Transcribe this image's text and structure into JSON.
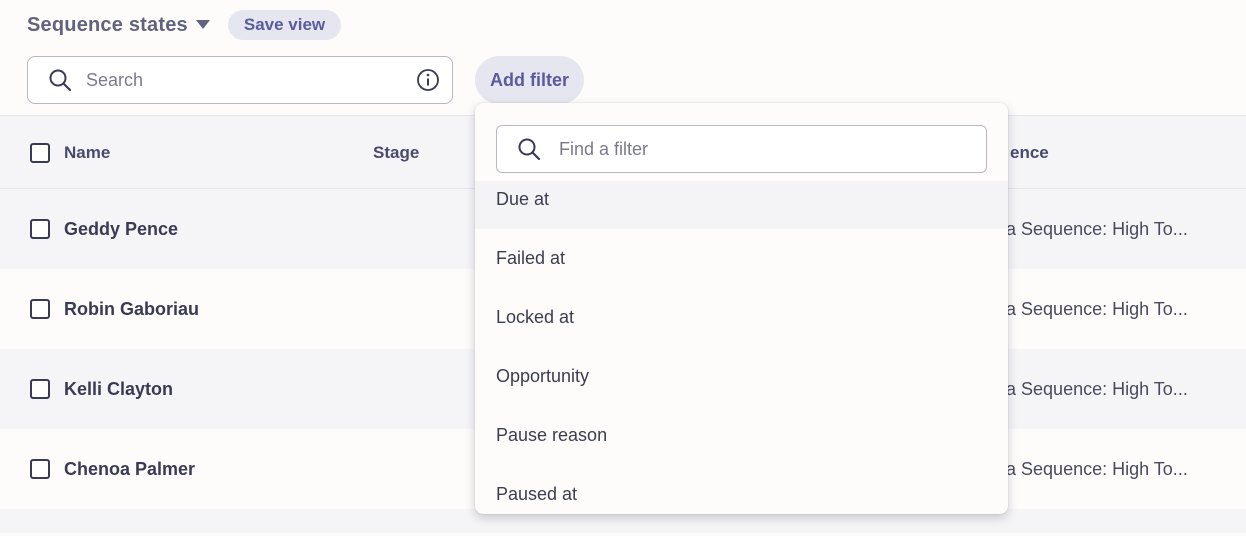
{
  "header": {
    "view_title": "Sequence states",
    "save_view_label": "Save view"
  },
  "toolbar": {
    "search_placeholder": "Search",
    "add_filter_label": "Add filter"
  },
  "table": {
    "columns": [
      "Name",
      "Stage",
      "ence"
    ],
    "rows": [
      {
        "name": "Geddy Pence",
        "sequence": "ona Sequence: High To..."
      },
      {
        "name": "Robin Gaboriau",
        "sequence": "ona Sequence: High To..."
      },
      {
        "name": "Kelli Clayton",
        "sequence": "ona Sequence: High To..."
      },
      {
        "name": "Chenoa Palmer",
        "sequence": "ona Sequence: High To..."
      }
    ]
  },
  "filter_dropdown": {
    "search_placeholder": "Find a filter",
    "items": [
      "Due at",
      "Failed at",
      "Locked at",
      "Opportunity",
      "Pause reason",
      "Paused at"
    ]
  },
  "colors": {
    "accent": "#5a5a9c",
    "pill_bg": "#e6e6f0",
    "row_alt": "#f5f5f8",
    "text": "#3a3a55"
  },
  "icons": {
    "caret": "caret-down-icon",
    "search": "search-icon",
    "info": "info-icon",
    "checkbox": "checkbox-icon"
  }
}
